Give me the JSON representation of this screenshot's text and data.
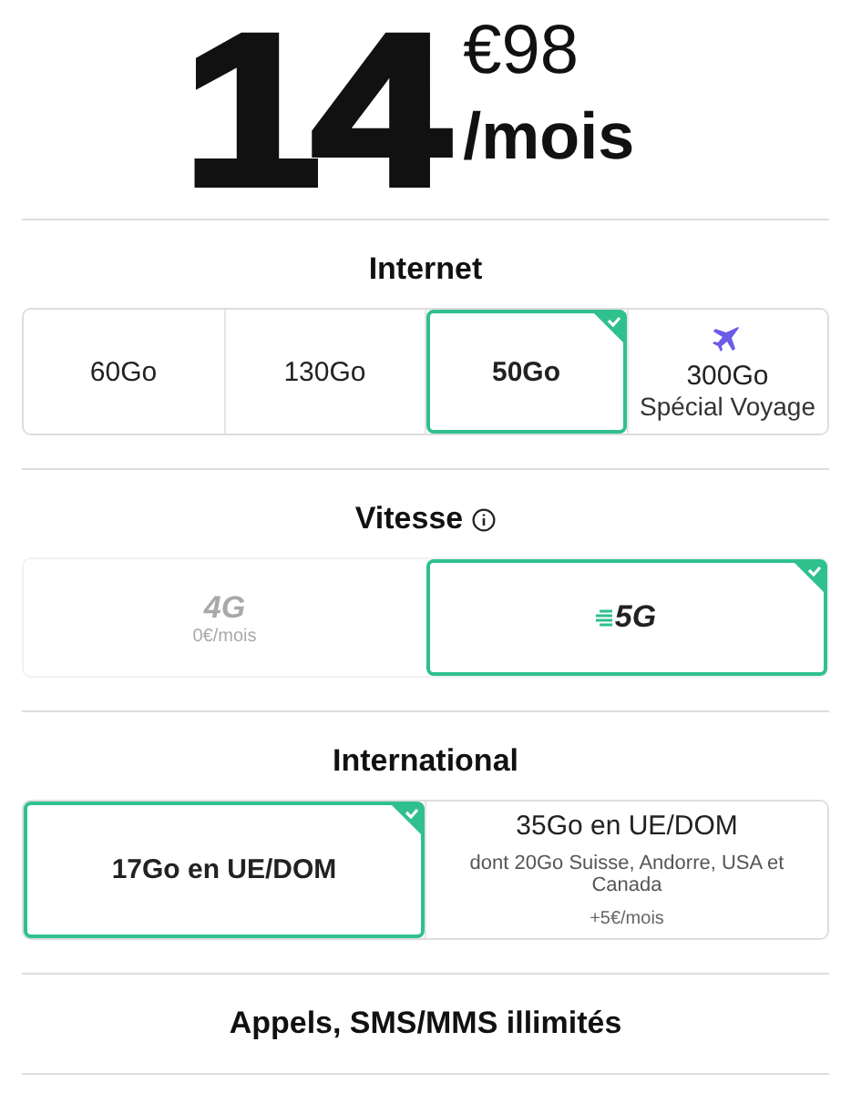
{
  "price": {
    "whole": "14",
    "cents": "€98",
    "period": "/mois"
  },
  "sections": [
    {
      "title": "Internet",
      "info": false,
      "options": [
        {
          "kind": "plain",
          "label": "60Go",
          "selected": false,
          "disabled": false
        },
        {
          "kind": "plain",
          "label": "130Go",
          "selected": false,
          "disabled": false
        },
        {
          "kind": "plain",
          "label": "50Go",
          "selected": true,
          "disabled": false
        },
        {
          "kind": "travel",
          "label": "300Go",
          "sublabel": "Spécial Voyage",
          "selected": false,
          "disabled": false
        }
      ]
    },
    {
      "title": "Vitesse",
      "info": true,
      "options": [
        {
          "kind": "plain",
          "label": "4G",
          "note": "0€/mois",
          "selected": false,
          "disabled": true
        },
        {
          "kind": "speed",
          "label": "5G",
          "selected": true,
          "disabled": false
        }
      ]
    },
    {
      "title": "International",
      "info": false,
      "options": [
        {
          "kind": "plain",
          "label": "17Go en UE/DOM",
          "selected": true,
          "disabled": false
        },
        {
          "kind": "plain",
          "label": "35Go en UE/DOM",
          "detail": "dont 20Go Suisse, Andorre, USA et Canada",
          "note": "+5€/mois",
          "selected": false,
          "disabled": false
        }
      ]
    },
    {
      "title": "Appels, SMS/MMS illimités",
      "info": false
    }
  ]
}
